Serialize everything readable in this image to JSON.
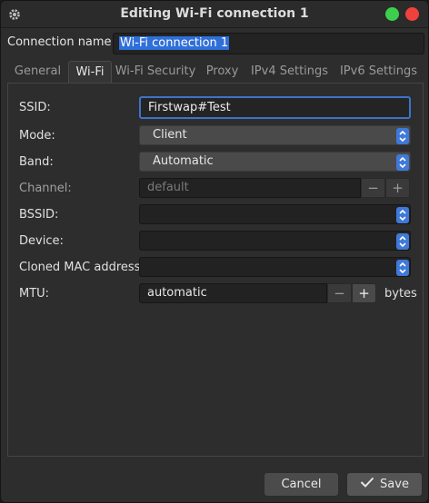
{
  "window": {
    "title": "Editing Wi-Fi connection 1"
  },
  "connection": {
    "label": "Connection name:",
    "value": "Wi-Fi connection 1"
  },
  "tabs": [
    {
      "label": "General"
    },
    {
      "label": "Wi-Fi"
    },
    {
      "label": "Wi-Fi Security"
    },
    {
      "label": "Proxy"
    },
    {
      "label": "IPv4 Settings"
    },
    {
      "label": "IPv6 Settings"
    }
  ],
  "active_tab": "Wi-Fi",
  "wifi": {
    "ssid": {
      "label": "SSID:",
      "value": "Firstwap#Test"
    },
    "mode": {
      "label": "Mode:",
      "value": "Client"
    },
    "band": {
      "label": "Band:",
      "value": "Automatic"
    },
    "channel": {
      "label": "Channel:",
      "placeholder": "default"
    },
    "bssid": {
      "label": "BSSID:",
      "value": ""
    },
    "device": {
      "label": "Device:",
      "value": ""
    },
    "cloned_mac": {
      "label": "Cloned MAC address:",
      "value": ""
    },
    "mtu": {
      "label": "MTU:",
      "value": "automatic",
      "unit": "bytes"
    }
  },
  "spin": {
    "minus": "−",
    "plus": "+"
  },
  "buttons": {
    "cancel": "Cancel",
    "save": "Save"
  },
  "colors": {
    "accent": "#3e73c8",
    "close": "#f0413c",
    "maximize": "#3ccf4e"
  }
}
